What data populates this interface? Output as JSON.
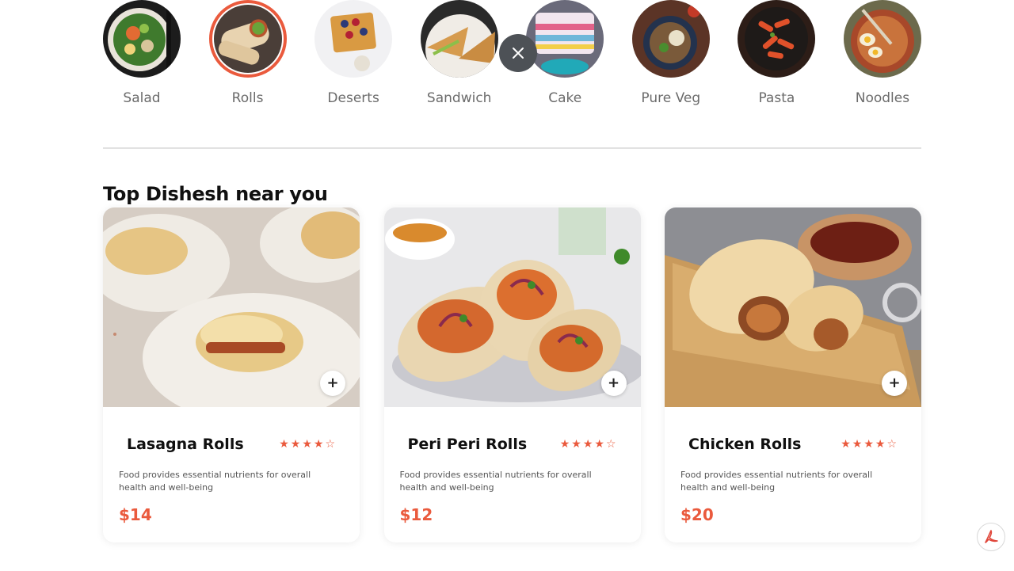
{
  "categories": [
    {
      "label": "Salad",
      "active": false
    },
    {
      "label": "Rolls",
      "active": true
    },
    {
      "label": "Deserts",
      "active": false
    },
    {
      "label": "Sandwich",
      "active": false
    },
    {
      "label": "Cake",
      "active": false
    },
    {
      "label": "Pure Veg",
      "active": false
    },
    {
      "label": "Pasta",
      "active": false
    },
    {
      "label": "Noodles",
      "active": false
    }
  ],
  "section": {
    "title": "Top Dishesh near you"
  },
  "dishes": [
    {
      "name": "Lasagna Rolls",
      "rating": 4,
      "description": "Food provides essential nutrients for overall health and well-being",
      "price": "$14"
    },
    {
      "name": "Peri Peri Rolls",
      "rating": 4,
      "description": "Food provides essential nutrients for overall health and well-being",
      "price": "$12"
    },
    {
      "name": "Chicken Rolls",
      "rating": 4,
      "description": "Food provides essential nutrients for overall health and well-being",
      "price": "$20"
    }
  ],
  "add_label": "+",
  "colors": {
    "accent": "#ea5a3d",
    "close_button": "#4d5156"
  },
  "icons": {
    "close": "close-icon",
    "pdf": "pdf-icon",
    "star": "star-icon"
  }
}
